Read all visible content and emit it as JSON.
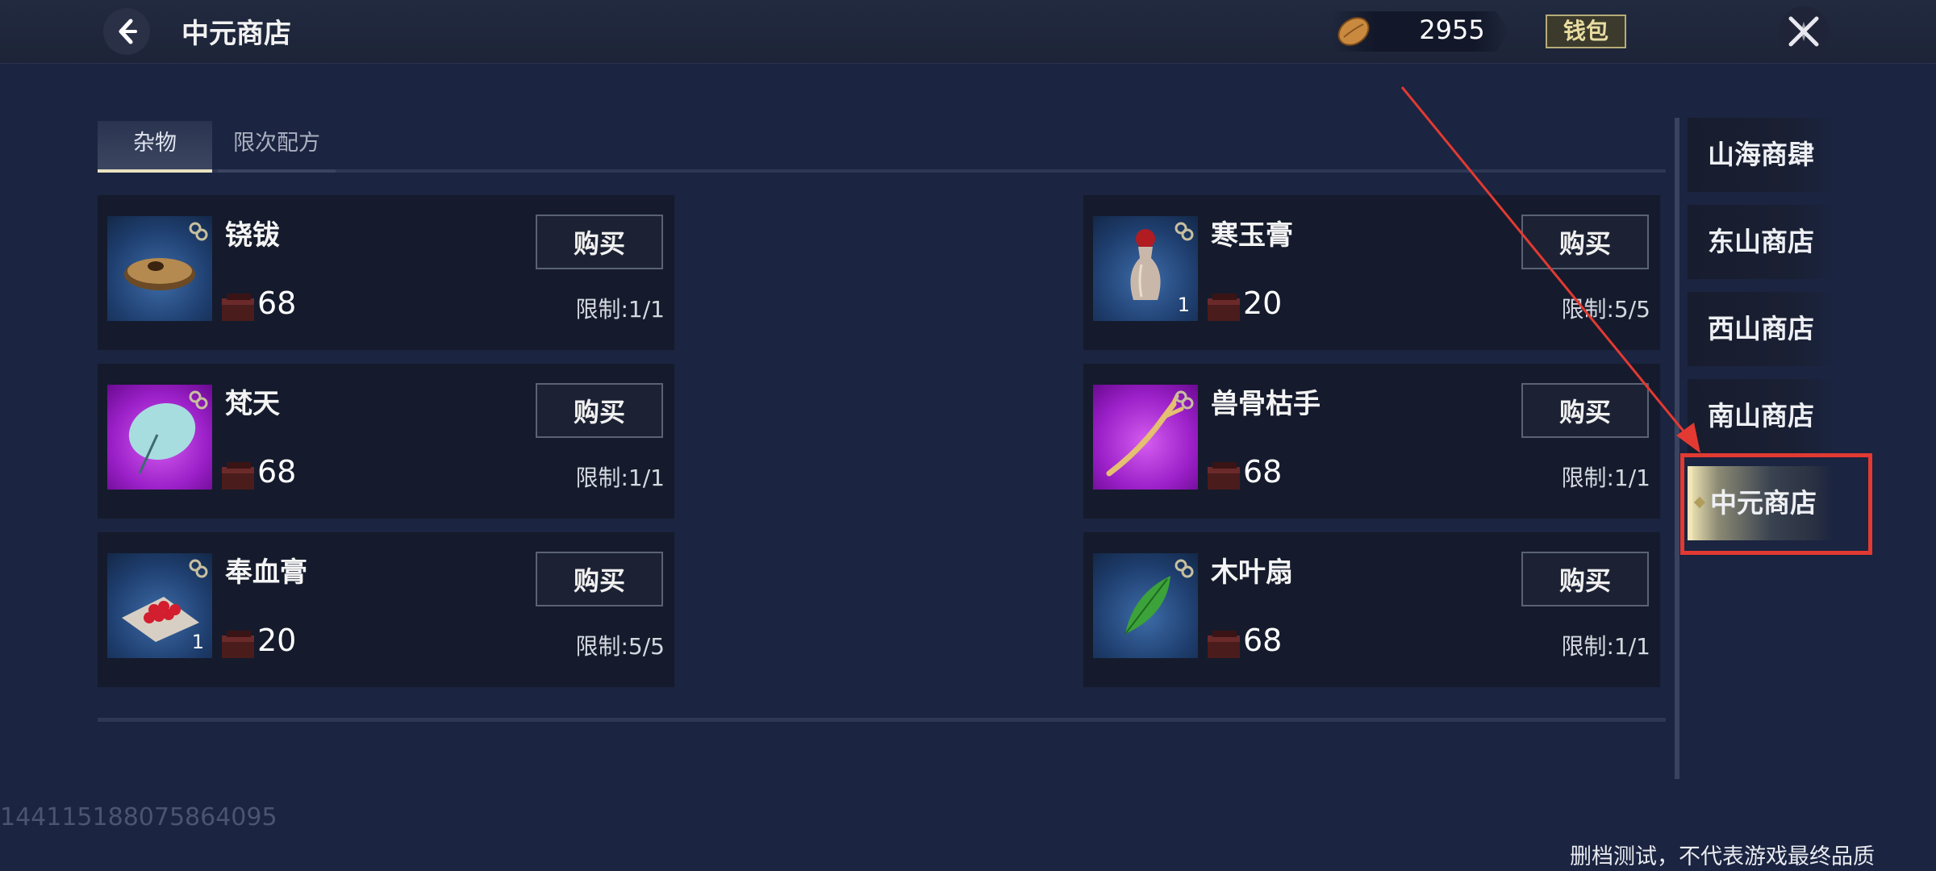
{
  "header": {
    "title": "中元商店",
    "currency_value": "2955",
    "wallet_label": "钱包"
  },
  "tabs": [
    {
      "label": "杂物",
      "active": true
    },
    {
      "label": "限次配方",
      "active": false
    }
  ],
  "items": [
    {
      "name": "铙钹",
      "price": "68",
      "limit": "限制:1/1",
      "buy_label": "购买",
      "icon": "cymbal-icon",
      "rarity": "blue"
    },
    {
      "name": "寒玉膏",
      "price": "20",
      "limit": "限制:5/5",
      "buy_label": "购买",
      "icon": "vase-icon",
      "rarity": "blue",
      "qty": "1"
    },
    {
      "name": "梵天",
      "price": "68",
      "limit": "限制:1/1",
      "buy_label": "购买",
      "icon": "umbrella-icon",
      "rarity": "purple"
    },
    {
      "name": "兽骨枯手",
      "price": "68",
      "limit": "限制:1/1",
      "buy_label": "购买",
      "icon": "bone-hand-icon",
      "rarity": "purple"
    },
    {
      "name": "奉血膏",
      "price": "20",
      "limit": "限制:5/5",
      "buy_label": "购买",
      "icon": "berries-icon",
      "rarity": "blue",
      "qty": "1"
    },
    {
      "name": "木叶扇",
      "price": "68",
      "limit": "限制:1/1",
      "buy_label": "购买",
      "icon": "leaf-fan-icon",
      "rarity": "blue"
    }
  ],
  "shops": [
    {
      "label": "山海商肆",
      "active": false
    },
    {
      "label": "东山商店",
      "active": false
    },
    {
      "label": "西山商店",
      "active": false
    },
    {
      "label": "南山商店",
      "active": false
    },
    {
      "label": "中元商店",
      "active": true
    }
  ],
  "debug_id": "1441151880758640​95",
  "footer_note": "删档测试，不代表游戏最终品质",
  "colors": {
    "background": "#1b2440",
    "highlight": "#e23a32",
    "wallet_gold": "#e8dca0"
  }
}
